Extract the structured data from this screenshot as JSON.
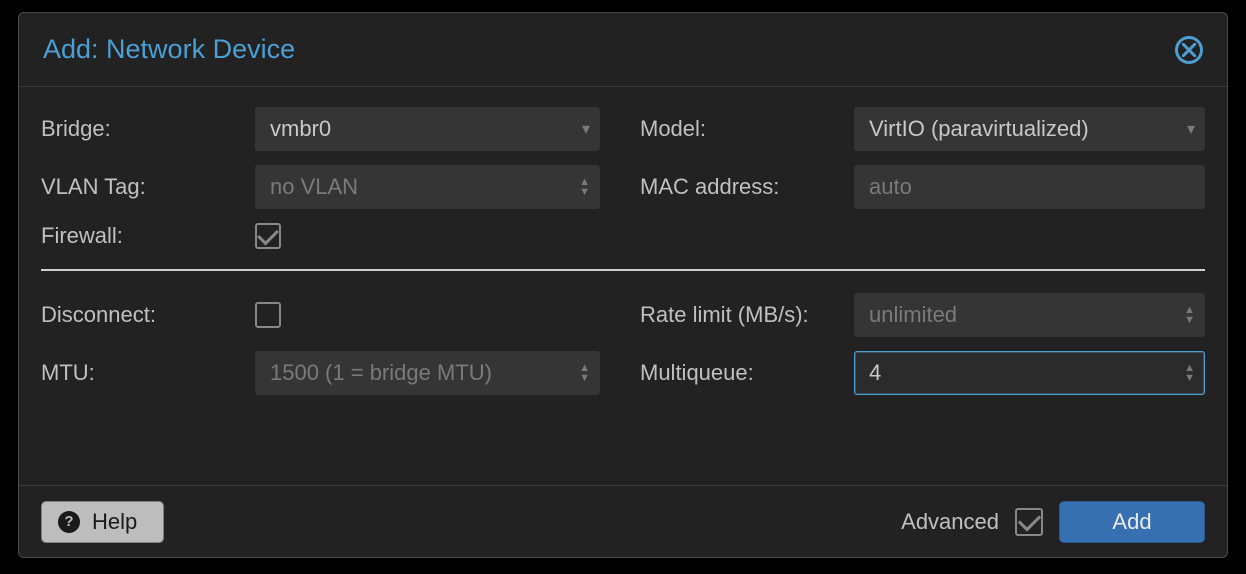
{
  "dialog": {
    "title": "Add: Network Device"
  },
  "fields": {
    "bridge": {
      "label": "Bridge:",
      "value": "vmbr0"
    },
    "model": {
      "label": "Model:",
      "value": "VirtIO (paravirtualized)"
    },
    "vlan": {
      "label": "VLAN Tag:",
      "value": "",
      "placeholder": "no VLAN"
    },
    "mac": {
      "label": "MAC address:",
      "value": "",
      "placeholder": "auto"
    },
    "firewall": {
      "label": "Firewall:",
      "checked": true
    },
    "disconnect": {
      "label": "Disconnect:",
      "checked": false
    },
    "ratelimit": {
      "label": "Rate limit (MB/s):",
      "value": "",
      "placeholder": "unlimited"
    },
    "mtu": {
      "label": "MTU:",
      "value": "",
      "placeholder": "1500 (1 = bridge MTU)"
    },
    "multiqueue": {
      "label": "Multiqueue:",
      "value": "4"
    }
  },
  "footer": {
    "help_label": "Help",
    "advanced_label": "Advanced",
    "advanced_checked": true,
    "add_label": "Add"
  }
}
